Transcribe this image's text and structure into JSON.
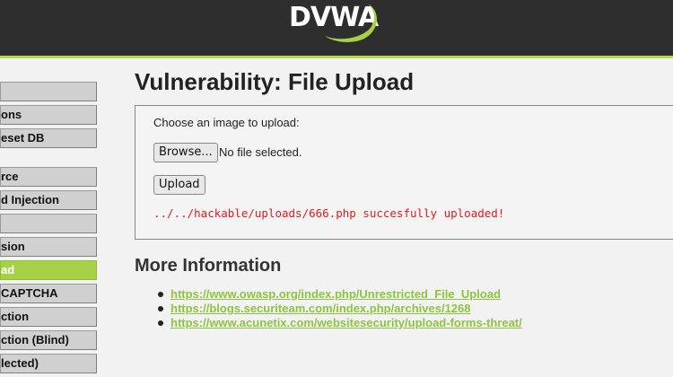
{
  "header": {
    "logo_text": "DVWA"
  },
  "menu": {
    "items": [
      {
        "label": ""
      },
      {
        "label": "ons"
      },
      {
        "label": "eset DB"
      },
      {
        "label": "rce"
      },
      {
        "label": "d Injection"
      },
      {
        "label": ""
      },
      {
        "label": "sion"
      },
      {
        "label": "ad",
        "selected": true
      },
      {
        "label": "CAPTCHA"
      },
      {
        "label": "ction"
      },
      {
        "label": "ction (Blind)"
      },
      {
        "label": "lected)"
      }
    ]
  },
  "page": {
    "title": "Vulnerability: File Upload",
    "choose_label": "Choose an image to upload:",
    "browse_label": "Browse...",
    "no_file_text": "No file selected.",
    "upload_label": "Upload",
    "result_message": "../../hackable/uploads/666.php succesfully uploaded!"
  },
  "more_info": {
    "heading": "More Information",
    "links": [
      "https://www.owasp.org/index.php/Unrestricted_File_Upload",
      "https://blogs.securiteam.com/index.php/archives/1268",
      "https://www.acunetix.com/websitesecurity/upload-forms-threat/"
    ]
  },
  "colors": {
    "header_bg": "#2e2e2e",
    "accent_green": "#a6d146",
    "link_green": "#8dc43e",
    "error_red": "#e01a1a"
  }
}
